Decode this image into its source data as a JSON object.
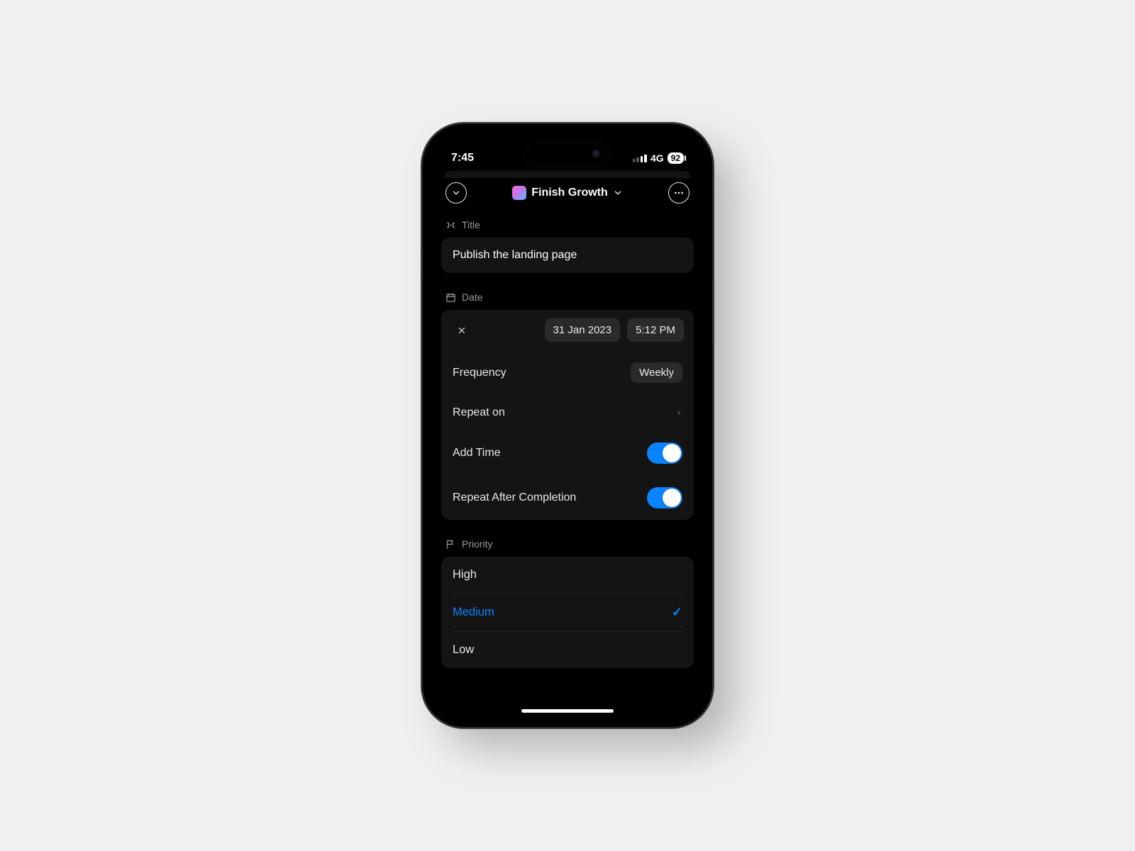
{
  "status": {
    "time": "7:45",
    "network": "4G",
    "battery": "92"
  },
  "nav": {
    "project_name": "Finish Growth"
  },
  "title": {
    "label": "Title",
    "value": "Publish the landing page"
  },
  "date": {
    "label": "Date",
    "date_value": "31 Jan 2023",
    "time_value": "5:12 PM",
    "frequency_label": "Frequency",
    "frequency_value": "Weekly",
    "repeat_on_label": "Repeat on",
    "add_time_label": "Add Time",
    "repeat_after_label": "Repeat After Completion"
  },
  "priority": {
    "label": "Priority",
    "selected_index": 1,
    "options": [
      "High",
      "Medium",
      "Low"
    ]
  }
}
